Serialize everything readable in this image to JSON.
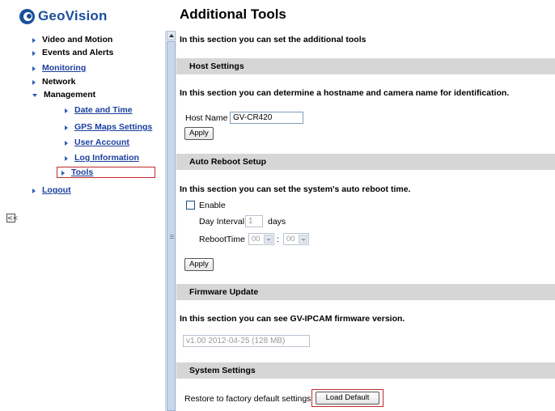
{
  "brand": {
    "name": "GeoVision"
  },
  "nav": {
    "items": [
      {
        "label": "Video and Motion"
      },
      {
        "label": "Events and Alerts"
      },
      {
        "label": "Monitoring"
      },
      {
        "label": "Network"
      },
      {
        "label": "Management"
      },
      {
        "label": "Date and Time"
      },
      {
        "label": "GPS Maps Settings"
      },
      {
        "label": "User Account"
      },
      {
        "label": "Log Information"
      },
      {
        "label": "Tools"
      },
      {
        "label": "Logout"
      }
    ],
    "collapse_label": "<<"
  },
  "main": {
    "title": "Additional Tools",
    "intro": "In this section you can set the additional tools",
    "host": {
      "header": "Host Settings",
      "desc": "In this section you can determine a hostname and camera name for identification.",
      "name_label": "Host Name",
      "name_value": "GV-CR420",
      "apply": "Apply"
    },
    "reboot": {
      "header": "Auto Reboot Setup",
      "desc": "In this section you can set the system's auto reboot time.",
      "enable_label": "Enable",
      "enable_checked": false,
      "interval_label": "Day Interval",
      "interval_value": "1",
      "interval_unit": "days",
      "time_label": "RebootTime",
      "hour": "00",
      "minute": "00",
      "sep": ":",
      "apply": "Apply"
    },
    "firmware": {
      "header": "Firmware Update",
      "desc": "In this section you can see GV-IPCAM firmware version.",
      "version": "v1.00 2012-04-25 (128 MB)"
    },
    "system": {
      "header": "System Settings",
      "restore_label": "Restore to factory default settings",
      "load_default": "Load Default"
    }
  },
  "colors": {
    "brand": "#1a4f9c",
    "link": "#1b3f9e",
    "highlight": "#c0282c",
    "section_bar": "#d6d6d6"
  }
}
